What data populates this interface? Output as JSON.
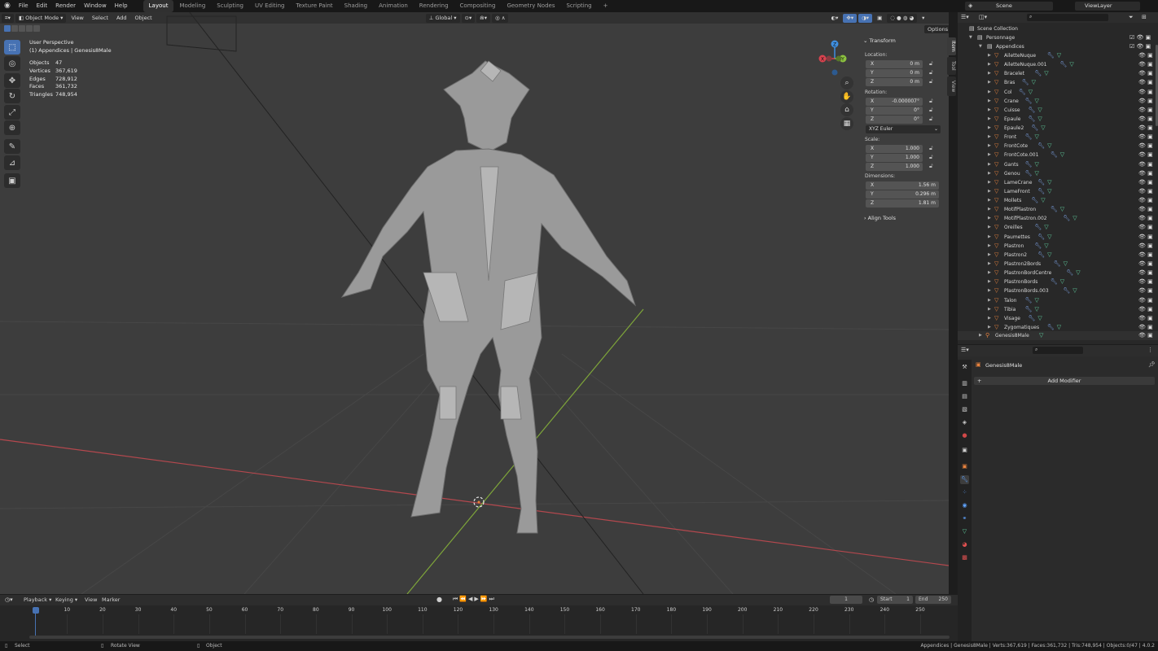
{
  "menu": [
    "File",
    "Edit",
    "Render",
    "Window",
    "Help"
  ],
  "workspaces": [
    "Layout",
    "Modeling",
    "Sculpting",
    "UV Editing",
    "Texture Paint",
    "Shading",
    "Animation",
    "Rendering",
    "Compositing",
    "Geometry Nodes",
    "Scripting"
  ],
  "add_tab": "+",
  "top_right": {
    "scene": "Scene",
    "view_layer": "ViewLayer"
  },
  "viewport": {
    "mode": "Object Mode",
    "header_menu": [
      "View",
      "Select",
      "Add",
      "Object"
    ],
    "transform_orientation": "Global",
    "options": "Options",
    "overlay_title": "User Perspective",
    "overlay_subtitle": "(1) Appendices | Genesis8Male",
    "stats": [
      [
        "Objects",
        "47"
      ],
      [
        "Vertices",
        "367,619"
      ],
      [
        "Edges",
        "728,912"
      ],
      [
        "Faces",
        "361,732"
      ],
      [
        "Triangles",
        "748,954"
      ]
    ],
    "gizmo": {
      "x": "X",
      "y": "Y",
      "z": "Z"
    }
  },
  "npanel": {
    "tabs": [
      "Item",
      "Tool",
      "View"
    ],
    "transform": "Transform",
    "location_label": "Location:",
    "location": [
      [
        "X",
        "0 m"
      ],
      [
        "Y",
        "0 m"
      ],
      [
        "Z",
        "0 m"
      ]
    ],
    "rotation_label": "Rotation:",
    "rotation": [
      [
        "X",
        "-0.000007°"
      ],
      [
        "Y",
        "0°"
      ],
      [
        "Z",
        "0°"
      ]
    ],
    "rotation_mode": "XYZ Euler",
    "scale_label": "Scale:",
    "scale": [
      [
        "X",
        "1.000"
      ],
      [
        "Y",
        "1.000"
      ],
      [
        "Z",
        "1.000"
      ]
    ],
    "dimensions_label": "Dimensions:",
    "dimensions": [
      [
        "X",
        "1.56 m"
      ],
      [
        "Y",
        "0.296 m"
      ],
      [
        "Z",
        "1.81 m"
      ]
    ],
    "align_tools": "Align Tools"
  },
  "outliner": {
    "scene_collection": "Scene Collection",
    "personnage": "Personnage",
    "appendices": "Appendices",
    "items": [
      "AiletteNuque",
      "AiletteNuque.001",
      "Bracelet",
      "Bras",
      "Col",
      "Crane",
      "Cuisse",
      "Epaule",
      "Epaule2",
      "Front",
      "FrontCote",
      "FrontCote.001",
      "Gants",
      "Genou",
      "LameCrane",
      "LameFront",
      "Mollets",
      "MotifPlastron",
      "MotifPlastron.002",
      "Oreilles",
      "Paumettes",
      "Plastron",
      "Plastron2",
      "Plastron2Bords",
      "PlastronBordCentre",
      "PlastronBords",
      "PlastronBords.003",
      "Talon",
      "Tibia",
      "Visage",
      "Zygomatiques"
    ],
    "genesis": "Genesis8Male"
  },
  "properties": {
    "object_name": "Genesis8Male",
    "add_modifier": "Add Modifier"
  },
  "timeline": {
    "menu": [
      "Playback",
      "Keying",
      "View",
      "Marker"
    ],
    "current_frame": "1",
    "start_label": "Start",
    "start": "1",
    "end_label": "End",
    "end": "250",
    "ticks": [
      "1",
      "10",
      "20",
      "30",
      "40",
      "50",
      "60",
      "70",
      "80",
      "90",
      "100",
      "110",
      "120",
      "130",
      "140",
      "150",
      "160",
      "170",
      "180",
      "190",
      "200",
      "210",
      "220",
      "230",
      "240",
      "250"
    ]
  },
  "status": {
    "select": "Select",
    "rotate": "Rotate View",
    "object": "Object",
    "right": "Appendices | Genesis8Male | Verts:367,619 | Faces:361,732 | Tris:748,954 | Objects:0/47 | 4.0.2"
  },
  "colors": {
    "accent": "#4772b3",
    "mesh_orange": "#e7823e",
    "x_axis": "#d9434f",
    "y_axis": "#8cc240",
    "z_axis": "#3f8fe0",
    "viewport_bg": "#3d3d3d"
  }
}
